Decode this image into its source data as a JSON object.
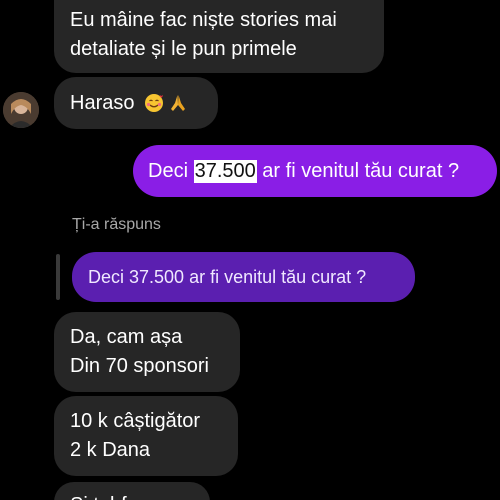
{
  "messages": {
    "m1_line1": "Eu mâine fac niște stories mai",
    "m1_line2": "detaliate și le pun primele",
    "m2_text": "Haraso",
    "m2_emojis": [
      "smiling-face-with-hearts",
      "folded-hands"
    ],
    "sent_prefix": "Deci ",
    "sent_highlight": "37.500",
    "sent_suffix": " ar fi venitul tău curat ?",
    "reply_label": "Ți-a răspuns",
    "quoted_text": "Deci 37.500 ar fi venitul tău curat ?",
    "m3_line1": "Da, cam așa",
    "m3_line2": "Din 70 sponsori",
    "m4_line1": "10 k câștigător",
    "m4_line2": "2 k Dana",
    "m5_partial": "Si tabfe"
  },
  "colors": {
    "sent_bubble": "#8a1ee6",
    "quoted_bubble": "#5b1fb0",
    "received_bubble": "#262626",
    "background": "#000000"
  }
}
